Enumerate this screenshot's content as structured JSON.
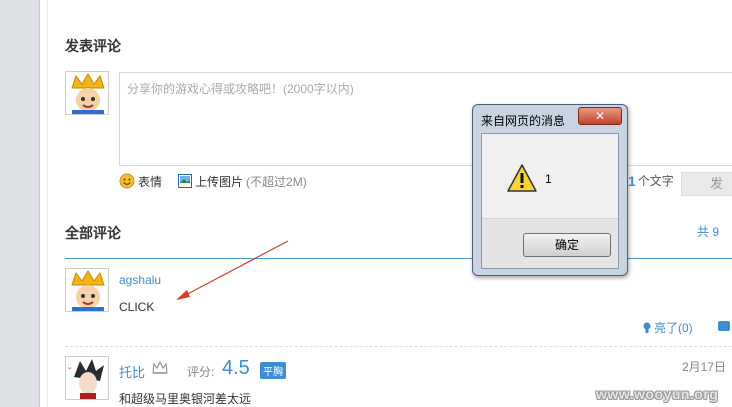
{
  "page": {
    "post_title": "发表评论",
    "all_comments_title": "全部评论",
    "all_comments_right": "共 9",
    "watermark": "www.wooyun.org"
  },
  "composer": {
    "placeholder": "分享你的游戏心得或攻略吧！(2000字以内)",
    "tool_emoji": "表情",
    "tool_upload": "上传图片",
    "tool_upload_hint": "(不超过2M)",
    "count": "1",
    "count_unit": "个文字",
    "submit_label": "发"
  },
  "comments": [
    {
      "user": "agshalu",
      "text": "CLICK",
      "likes_label": "亮了(0)"
    },
    {
      "user": "托比",
      "score_label": "评分:",
      "score": "4.5",
      "badge": "平胸",
      "date": "2月17日",
      "text": "和超级马里奥银河差太远"
    }
  ],
  "dialog": {
    "title": "来自网页的消息",
    "close_label": "✕",
    "message": "1",
    "ok_label": "确定"
  },
  "colors": {
    "accent": "#3b8ed4",
    "arrow": "#d93a2b"
  }
}
